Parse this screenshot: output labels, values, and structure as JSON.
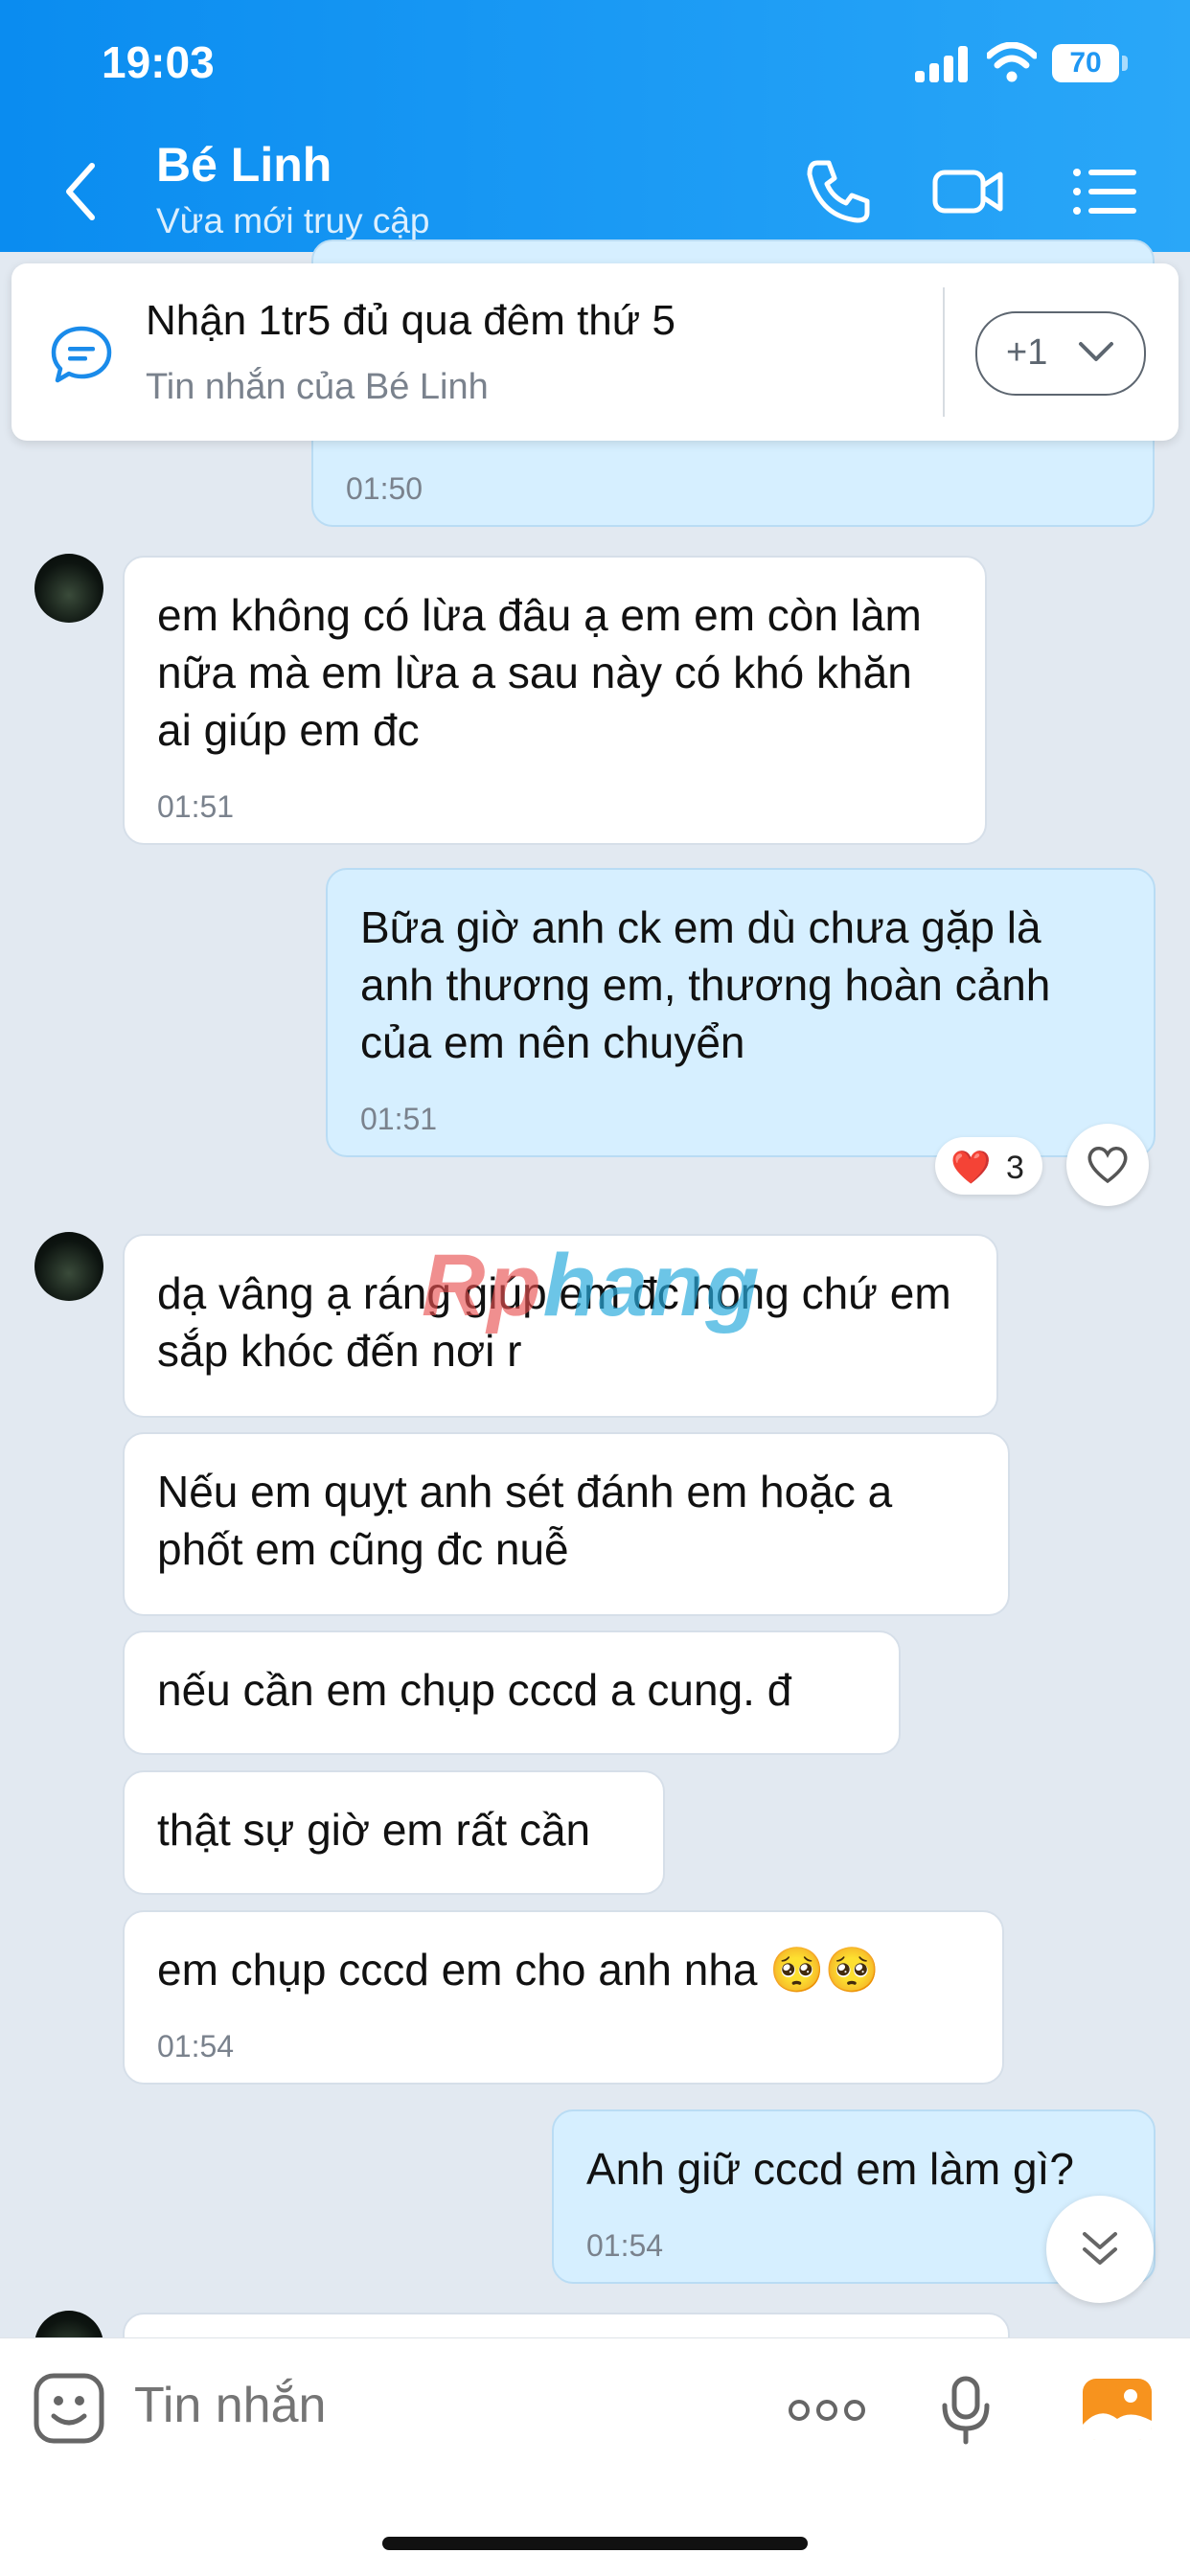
{
  "status_bar": {
    "time": "19:03",
    "battery": "70"
  },
  "header": {
    "contact_name": "Bé Linh",
    "contact_status": "Vừa mới truy cập"
  },
  "pinned": {
    "text": "Nhận 1tr5 đủ qua đêm thứ 5",
    "subtitle": "Tin nhắn của Bé Linh",
    "more_label": "+1"
  },
  "messages": [
    {
      "id": "m0",
      "from": "me",
      "text": "",
      "time": "01:50"
    },
    {
      "id": "m1",
      "from": "them",
      "text": "em không có lừa đâu ạ em em còn làm nữa mà em lừa a sau này có khó khăn ai giúp em đc",
      "time": "01:51"
    },
    {
      "id": "m2",
      "from": "me",
      "text": "Bữa giờ anh ck em dù chưa gặp là anh thương em, thương hoàn cảnh của em nên chuyển",
      "time": "01:51",
      "reaction": {
        "emoji": "❤️",
        "count": "3"
      }
    },
    {
      "id": "m3",
      "from": "them",
      "text": "dạ vâng ạ ráng giúp em đc hong chứ em sắp khóc đến nơi r",
      "time": ""
    },
    {
      "id": "m4",
      "from": "them",
      "text": "Nếu em quỵt anh sét đánh em hoặc a phốt em cũng đc nuễ",
      "time": ""
    },
    {
      "id": "m5",
      "from": "them",
      "text": "nếu cần em chụp cccd a cung. đ",
      "time": ""
    },
    {
      "id": "m6",
      "from": "them",
      "text": "thật sự giờ em rất cần",
      "time": ""
    },
    {
      "id": "m7",
      "from": "them",
      "text": "em chụp cccd em cho anh nha 🥺🥺",
      "time": "01:54"
    },
    {
      "id": "m8",
      "from": "me",
      "text": "Anh giữ cccd em làm gì?",
      "time": "01:54"
    }
  ],
  "watermark": {
    "part1": "Rp",
    "part2": "hang"
  },
  "composer": {
    "placeholder": "Tin nhắn"
  },
  "colors": {
    "header": "#1a9af5",
    "sent_bubble": "#d6efff",
    "background": "#e2e9f1"
  }
}
